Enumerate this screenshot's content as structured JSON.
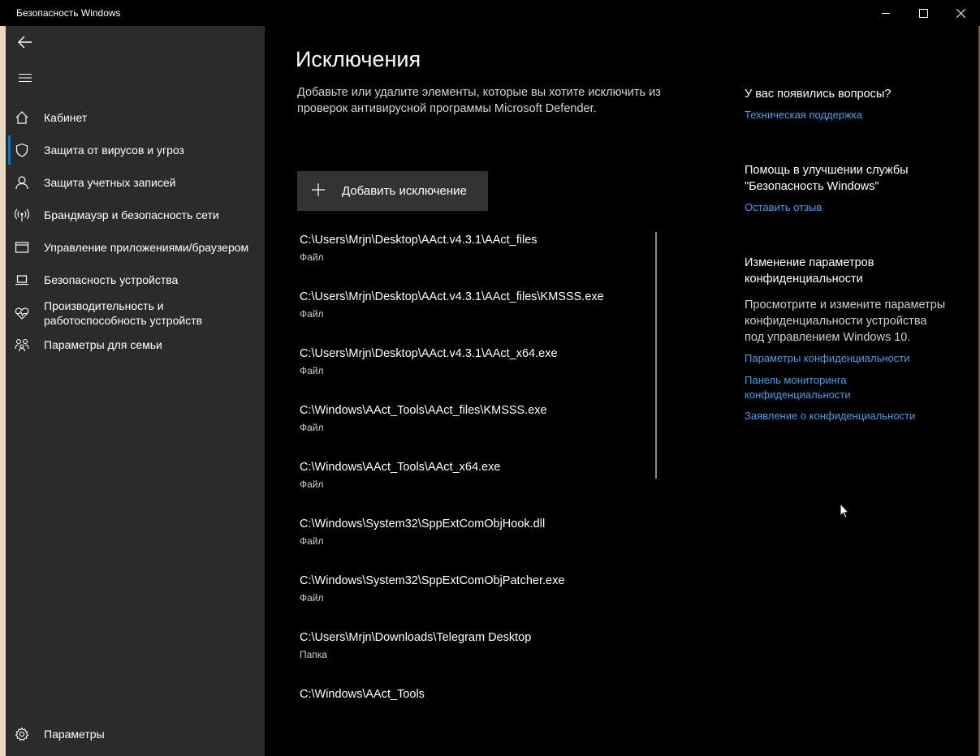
{
  "window": {
    "title": "Безопасность Windows"
  },
  "sidebar": {
    "items": [
      {
        "label": "Кабинет",
        "icon": "home-icon"
      },
      {
        "label": "Защита от вирусов и угроз",
        "icon": "shield-icon"
      },
      {
        "label": "Защита учетных записей",
        "icon": "person-icon"
      },
      {
        "label": "Брандмауэр и безопасность сети",
        "icon": "wifi-antenna-icon"
      },
      {
        "label": "Управление приложениями/браузером",
        "icon": "app-window-icon"
      },
      {
        "label": "Безопасность устройства",
        "icon": "laptop-icon"
      },
      {
        "label": "Производительность и работоспособность устройств",
        "icon": "heart-pulse-icon"
      },
      {
        "label": "Параметры для семьи",
        "icon": "family-icon"
      }
    ],
    "settings_label": "Параметры"
  },
  "main": {
    "title": "Исключения",
    "description": "Добавьте или удалите элементы, которые вы хотите исключить из проверок антивирусной программы Microsoft Defender.",
    "add_button_label": "Добавить исключение",
    "exclusions": [
      {
        "path": "C:\\Users\\Mrjn\\Desktop\\AAct.v4.3.1\\AAct_files",
        "type": "Файл"
      },
      {
        "path": "C:\\Users\\Mrjn\\Desktop\\AAct.v4.3.1\\AAct_files\\KMSSS.exe",
        "type": "Файл"
      },
      {
        "path": "C:\\Users\\Mrjn\\Desktop\\AAct.v4.3.1\\AAct_x64.exe",
        "type": "Файл"
      },
      {
        "path": "C:\\Windows\\AAct_Tools\\AAct_files\\KMSSS.exe",
        "type": "Файл"
      },
      {
        "path": "C:\\Windows\\AAct_Tools\\AAct_x64.exe",
        "type": "Файл"
      },
      {
        "path": "C:\\Windows\\System32\\SppExtComObjHook.dll",
        "type": "Файл"
      },
      {
        "path": "C:\\Windows\\System32\\SppExtComObjPatcher.exe",
        "type": "Файл"
      },
      {
        "path": "C:\\Users\\Mrjn\\Downloads\\Telegram Desktop",
        "type": "Папка"
      },
      {
        "path": "C:\\Windows\\AAct_Tools",
        "type": ""
      }
    ]
  },
  "right": {
    "questions_heading": "У вас появились вопросы?",
    "support_link": "Техническая поддержка",
    "improve_heading": "Помощь в улучшении службы \"Безопасность Windows\"",
    "feedback_link": "Оставить отзыв",
    "privacy_heading": "Изменение параметров конфиденциальности",
    "privacy_text": "Просмотрите и измените параметры конфиденциальности устройства под управлением Windows 10.",
    "privacy_links": [
      "Параметры конфиденциальности",
      "Панель мониторинга конфиденциальности",
      "Заявление о конфиденциальности"
    ]
  },
  "colors": {
    "accent": "#0078d7",
    "link": "#4c9de6",
    "sidebar_bg": "#2b2b2b",
    "content_bg": "#000000",
    "button_bg": "#333333"
  }
}
